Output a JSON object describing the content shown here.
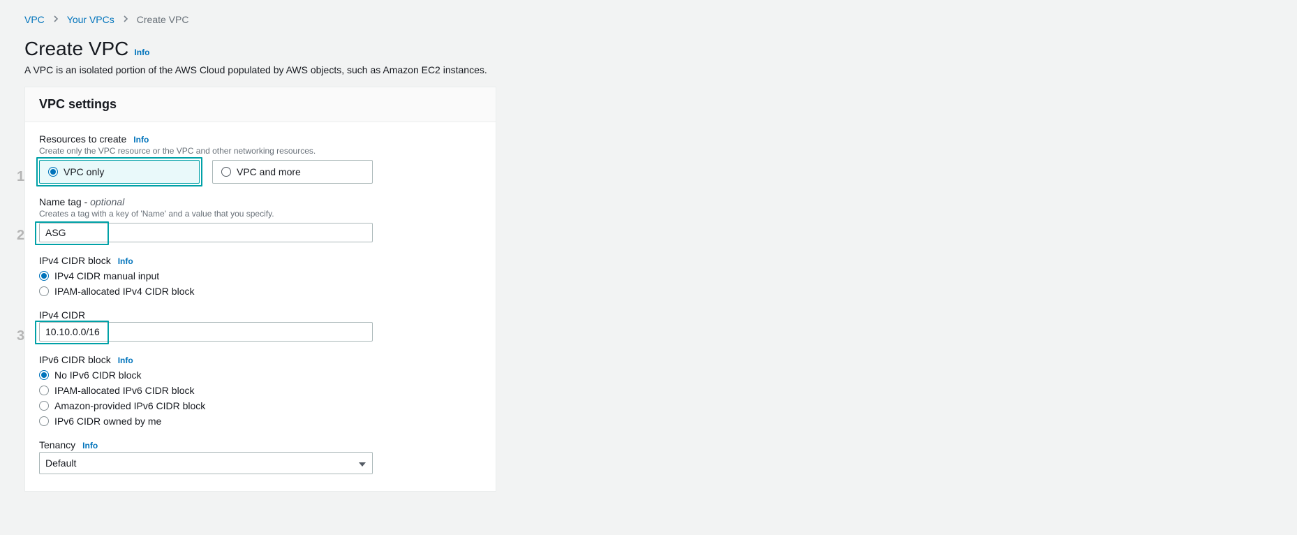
{
  "breadcrumb": {
    "items": [
      {
        "label": "VPC",
        "link": true
      },
      {
        "label": "Your VPCs",
        "link": true
      },
      {
        "label": "Create VPC",
        "link": false
      }
    ]
  },
  "heading": {
    "title": "Create VPC",
    "info": "Info",
    "description": "A VPC is an isolated portion of the AWS Cloud populated by AWS objects, such as Amazon EC2 instances."
  },
  "panel": {
    "title": "VPC settings"
  },
  "resources_to_create": {
    "label": "Resources to create",
    "info": "Info",
    "hint": "Create only the VPC resource or the VPC and other networking resources.",
    "option_vpc_only": "VPC only",
    "option_vpc_and_more": "VPC and more"
  },
  "name_tag": {
    "label": "Name tag - ",
    "optional": "optional",
    "hint": "Creates a tag with a key of 'Name' and a value that you specify.",
    "value": "ASG"
  },
  "ipv4_cidr_block": {
    "label": "IPv4 CIDR block",
    "info": "Info",
    "option_manual": "IPv4 CIDR manual input",
    "option_ipam": "IPAM-allocated IPv4 CIDR block"
  },
  "ipv4_cidr": {
    "label": "IPv4 CIDR",
    "value": "10.10.0.0/16"
  },
  "ipv6_cidr_block": {
    "label": "IPv6 CIDR block",
    "info": "Info",
    "option_none": "No IPv6 CIDR block",
    "option_ipam": "IPAM-allocated IPv6 CIDR block",
    "option_amazon": "Amazon-provided IPv6 CIDR block",
    "option_owned": "IPv6 CIDR owned by me"
  },
  "tenancy": {
    "label": "Tenancy",
    "info": "Info",
    "value": "Default"
  },
  "steps": {
    "s1": "1",
    "s2": "2",
    "s3": "3"
  }
}
